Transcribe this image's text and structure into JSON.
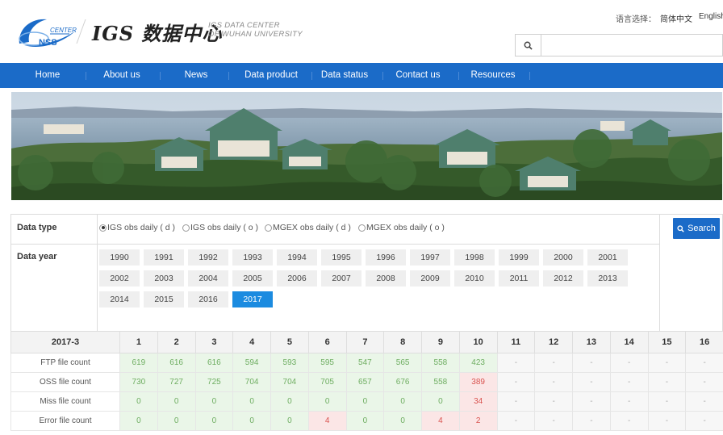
{
  "header": {
    "logo_top": "CENTER",
    "logo_bottom": "NSS",
    "brand_title": "IGS 数据中心",
    "brand_sub_line1": "IGS DATA CENTER",
    "brand_sub_line2": "OF WUHAN UNIVERSITY",
    "lang_label": "语言选择：",
    "lang_cn": "简体中文",
    "lang_en": "English",
    "search_placeholder": ""
  },
  "nav": {
    "items": [
      "Home",
      "About us",
      "News",
      "Data product",
      "Data status",
      "Contact us",
      "Resources"
    ]
  },
  "filter": {
    "data_type_label": "Data type",
    "data_year_label": "Data year",
    "search_label": "Search",
    "types": [
      {
        "label": "IGS obs daily ( d )",
        "selected": true
      },
      {
        "label": "IGS obs daily ( o )",
        "selected": false
      },
      {
        "label": "MGEX obs daily ( d )",
        "selected": false
      },
      {
        "label": "MGEX obs daily ( o )",
        "selected": false
      }
    ],
    "years": [
      "1990",
      "1991",
      "1992",
      "1993",
      "1994",
      "1995",
      "1996",
      "1997",
      "1998",
      "1999",
      "2000",
      "2001",
      "2002",
      "2003",
      "2004",
      "2005",
      "2006",
      "2007",
      "2008",
      "2009",
      "2010",
      "2011",
      "2012",
      "2013",
      "2014",
      "2015",
      "2016",
      "2017"
    ],
    "selected_year": "2017"
  },
  "table": {
    "period": "2017-3",
    "days": [
      "1",
      "2",
      "3",
      "4",
      "5",
      "6",
      "7",
      "8",
      "9",
      "10",
      "11",
      "12",
      "13",
      "14",
      "15",
      "16"
    ],
    "rows": [
      {
        "label": "FTP file count",
        "values": [
          "619",
          "616",
          "616",
          "594",
          "593",
          "595",
          "547",
          "565",
          "558",
          "423",
          "-",
          "-",
          "-",
          "-",
          "-",
          "-"
        ]
      },
      {
        "label": "OSS file count",
        "values": [
          "730",
          "727",
          "725",
          "704",
          "704",
          "705",
          "657",
          "676",
          "558",
          "389",
          "-",
          "-",
          "-",
          "-",
          "-",
          "-"
        ]
      },
      {
        "label": "Miss file count",
        "values": [
          "0",
          "0",
          "0",
          "0",
          "0",
          "0",
          "0",
          "0",
          "0",
          "34",
          "-",
          "-",
          "-",
          "-",
          "-",
          "-"
        ]
      },
      {
        "label": "Error file count",
        "values": [
          "0",
          "0",
          "0",
          "0",
          "0",
          "4",
          "0",
          "0",
          "4",
          "2",
          "-",
          "-",
          "-",
          "-",
          "-",
          "-"
        ]
      }
    ],
    "status": [
      [
        "ok",
        "ok",
        "ok",
        "ok",
        "ok",
        "ok",
        "ok",
        "ok",
        "ok",
        "ok",
        "na",
        "na",
        "na",
        "na",
        "na",
        "na"
      ],
      [
        "ok",
        "ok",
        "ok",
        "ok",
        "ok",
        "ok",
        "ok",
        "ok",
        "ok",
        "bad",
        "na",
        "na",
        "na",
        "na",
        "na",
        "na"
      ],
      [
        "ok",
        "ok",
        "ok",
        "ok",
        "ok",
        "ok",
        "ok",
        "ok",
        "ok",
        "bad",
        "na",
        "na",
        "na",
        "na",
        "na",
        "na"
      ],
      [
        "ok",
        "ok",
        "ok",
        "ok",
        "ok",
        "bad",
        "ok",
        "ok",
        "bad",
        "bad",
        "na",
        "na",
        "na",
        "na",
        "na",
        "na"
      ]
    ]
  },
  "colors": {
    "brand_blue": "#1b6bc8",
    "active_year": "#1b8be0",
    "ok_bg": "#eaf6e8",
    "bad_bg": "#fbe6e6"
  },
  "icons": {
    "search": "search-icon",
    "logo": "satellite-swoosh-logo"
  }
}
